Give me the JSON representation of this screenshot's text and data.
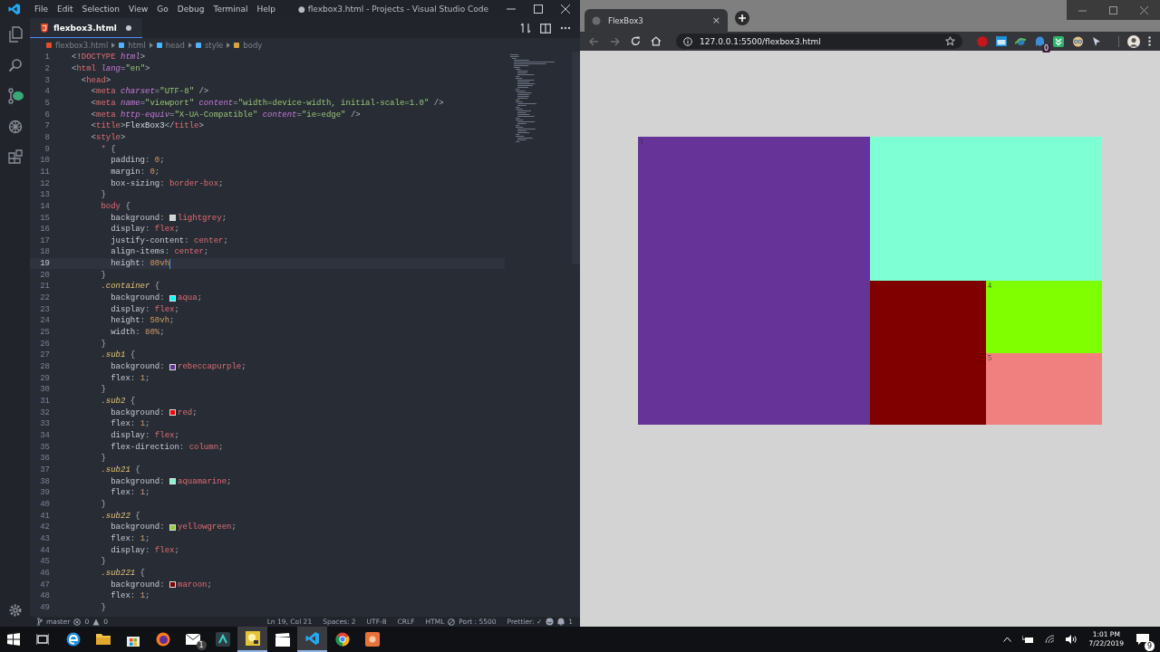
{
  "vscode": {
    "title": "● flexbox3.html - Projects - Visual Studio Code",
    "menu": [
      "File",
      "Edit",
      "Selection",
      "View",
      "Go",
      "Debug",
      "Terminal",
      "Help"
    ],
    "tab": {
      "label": "flexbox3.html",
      "modified": true,
      "selected": true
    },
    "breadcrumbs": [
      {
        "kind": "file",
        "label": "flexbox3.html"
      },
      {
        "kind": "element",
        "label": "html"
      },
      {
        "kind": "element",
        "label": "head"
      },
      {
        "kind": "element",
        "label": "style"
      },
      {
        "kind": "rule",
        "label": "body"
      }
    ],
    "lines": [
      {
        "number": "1",
        "current": false,
        "tokens": [
          {
            "kind": "punct",
            "text": "<!"
          },
          {
            "kind": "tag",
            "text": "DOCTYPE"
          },
          {
            "kind": "attr",
            "text": " html"
          },
          {
            "kind": "punct",
            "text": ">"
          }
        ]
      },
      {
        "number": "2",
        "current": false,
        "tokens": [
          {
            "kind": "punct",
            "text": "<"
          },
          {
            "kind": "tag",
            "text": "html"
          },
          {
            "kind": "attr",
            "text": " lang"
          },
          {
            "kind": "punct",
            "text": "="
          },
          {
            "kind": "string",
            "text": "\"en\""
          },
          {
            "kind": "punct",
            "text": ">"
          }
        ]
      },
      {
        "number": "3",
        "current": false,
        "tokens": [
          {
            "kind": "punct",
            "text": "  <"
          },
          {
            "kind": "tag",
            "text": "head"
          },
          {
            "kind": "punct",
            "text": ">"
          }
        ]
      },
      {
        "number": "4",
        "current": false,
        "tokens": [
          {
            "kind": "punct",
            "text": "    <"
          },
          {
            "kind": "tag",
            "text": "meta"
          },
          {
            "kind": "attr",
            "text": " charset"
          },
          {
            "kind": "punct",
            "text": "="
          },
          {
            "kind": "string",
            "text": "\"UTF-8\""
          },
          {
            "kind": "punct",
            "text": " />"
          }
        ]
      },
      {
        "number": "5",
        "current": false,
        "tokens": [
          {
            "kind": "punct",
            "text": "    <"
          },
          {
            "kind": "tag",
            "text": "meta"
          },
          {
            "kind": "attr",
            "text": " name"
          },
          {
            "kind": "punct",
            "text": "="
          },
          {
            "kind": "string",
            "text": "\"viewport\""
          },
          {
            "kind": "attr",
            "text": " content"
          },
          {
            "kind": "punct",
            "text": "="
          },
          {
            "kind": "string",
            "text": "\"width=device-width, initial-scale=1.0\""
          },
          {
            "kind": "punct",
            "text": " />"
          }
        ]
      },
      {
        "number": "6",
        "current": false,
        "tokens": [
          {
            "kind": "punct",
            "text": "    <"
          },
          {
            "kind": "tag",
            "text": "meta"
          },
          {
            "kind": "attr",
            "text": " http-equiv"
          },
          {
            "kind": "punct",
            "text": "="
          },
          {
            "kind": "string",
            "text": "\"X-UA-Compatible\""
          },
          {
            "kind": "attr",
            "text": " content"
          },
          {
            "kind": "punct",
            "text": "="
          },
          {
            "kind": "string",
            "text": "\"ie=edge\""
          },
          {
            "kind": "punct",
            "text": " />"
          }
        ]
      },
      {
        "number": "7",
        "current": false,
        "tokens": [
          {
            "kind": "punct",
            "text": "    <"
          },
          {
            "kind": "tag",
            "text": "title"
          },
          {
            "kind": "punct",
            "text": ">"
          },
          {
            "kind": "text",
            "text": "FlexBox3"
          },
          {
            "kind": "punct",
            "text": "</"
          },
          {
            "kind": "tag",
            "text": "title"
          },
          {
            "kind": "punct",
            "text": ">"
          }
        ]
      },
      {
        "number": "8",
        "current": false,
        "tokens": [
          {
            "kind": "punct",
            "text": "    <"
          },
          {
            "kind": "tag",
            "text": "style"
          },
          {
            "kind": "punct",
            "text": ">"
          }
        ]
      },
      {
        "number": "9",
        "current": false,
        "tokens": [
          {
            "kind": "tag",
            "text": "      *"
          },
          {
            "kind": "punct",
            "text": " {"
          }
        ]
      },
      {
        "number": "10",
        "current": false,
        "tokens": [
          {
            "kind": "property",
            "text": "        padding"
          },
          {
            "kind": "punct",
            "text": ": "
          },
          {
            "kind": "number",
            "text": "0"
          },
          {
            "kind": "punct",
            "text": ";"
          }
        ]
      },
      {
        "number": "11",
        "current": false,
        "tokens": [
          {
            "kind": "property",
            "text": "        margin"
          },
          {
            "kind": "punct",
            "text": ": "
          },
          {
            "kind": "number",
            "text": "0"
          },
          {
            "kind": "punct",
            "text": ";"
          }
        ]
      },
      {
        "number": "12",
        "current": false,
        "tokens": [
          {
            "kind": "property",
            "text": "        box-sizing"
          },
          {
            "kind": "punct",
            "text": ": "
          },
          {
            "kind": "value",
            "text": "border-box"
          },
          {
            "kind": "punct",
            "text": ";"
          }
        ]
      },
      {
        "number": "13",
        "current": false,
        "tokens": [
          {
            "kind": "punct",
            "text": "      }"
          }
        ]
      },
      {
        "number": "14",
        "current": false,
        "tokens": [
          {
            "kind": "tag",
            "text": "      body"
          },
          {
            "kind": "punct",
            "text": " {"
          }
        ]
      },
      {
        "number": "15",
        "current": false,
        "tokens": [
          {
            "kind": "property",
            "text": "        background"
          },
          {
            "kind": "punct",
            "text": ": "
          },
          {
            "kind": "swatch",
            "color": "#d3d3d3"
          },
          {
            "kind": "value",
            "text": "lightgrey"
          },
          {
            "kind": "punct",
            "text": ";"
          }
        ]
      },
      {
        "number": "16",
        "current": false,
        "tokens": [
          {
            "kind": "property",
            "text": "        display"
          },
          {
            "kind": "punct",
            "text": ": "
          },
          {
            "kind": "value",
            "text": "flex"
          },
          {
            "kind": "punct",
            "text": ";"
          }
        ]
      },
      {
        "number": "17",
        "current": false,
        "tokens": [
          {
            "kind": "property",
            "text": "        justify-content"
          },
          {
            "kind": "punct",
            "text": ": "
          },
          {
            "kind": "value",
            "text": "center"
          },
          {
            "kind": "punct",
            "text": ";"
          }
        ]
      },
      {
        "number": "18",
        "current": false,
        "tokens": [
          {
            "kind": "property",
            "text": "        align-items"
          },
          {
            "kind": "punct",
            "text": ": "
          },
          {
            "kind": "value",
            "text": "center"
          },
          {
            "kind": "punct",
            "text": ";"
          }
        ]
      },
      {
        "number": "19",
        "current": true,
        "tokens": [
          {
            "kind": "property",
            "text": "        height"
          },
          {
            "kind": "punct",
            "text": ": "
          },
          {
            "kind": "number",
            "text": "80vh"
          }
        ]
      },
      {
        "number": "20",
        "current": false,
        "tokens": [
          {
            "kind": "punct",
            "text": "      }"
          }
        ]
      },
      {
        "number": "21",
        "current": false,
        "tokens": [
          {
            "kind": "class",
            "text": "      .container"
          },
          {
            "kind": "punct",
            "text": " {"
          }
        ]
      },
      {
        "number": "22",
        "current": false,
        "tokens": [
          {
            "kind": "property",
            "text": "        background"
          },
          {
            "kind": "punct",
            "text": ": "
          },
          {
            "kind": "swatch",
            "color": "#00ffff"
          },
          {
            "kind": "value",
            "text": "aqua"
          },
          {
            "kind": "punct",
            "text": ";"
          }
        ]
      },
      {
        "number": "23",
        "current": false,
        "tokens": [
          {
            "kind": "property",
            "text": "        display"
          },
          {
            "kind": "punct",
            "text": ": "
          },
          {
            "kind": "value",
            "text": "flex"
          },
          {
            "kind": "punct",
            "text": ";"
          }
        ]
      },
      {
        "number": "24",
        "current": false,
        "tokens": [
          {
            "kind": "property",
            "text": "        height"
          },
          {
            "kind": "punct",
            "text": ": "
          },
          {
            "kind": "number",
            "text": "50vh"
          },
          {
            "kind": "punct",
            "text": ";"
          }
        ]
      },
      {
        "number": "25",
        "current": false,
        "tokens": [
          {
            "kind": "property",
            "text": "        width"
          },
          {
            "kind": "punct",
            "text": ": "
          },
          {
            "kind": "number",
            "text": "80%"
          },
          {
            "kind": "punct",
            "text": ";"
          }
        ]
      },
      {
        "number": "26",
        "current": false,
        "tokens": [
          {
            "kind": "punct",
            "text": "      }"
          }
        ]
      },
      {
        "number": "27",
        "current": false,
        "tokens": [
          {
            "kind": "class",
            "text": "      .sub1"
          },
          {
            "kind": "punct",
            "text": " {"
          }
        ]
      },
      {
        "number": "28",
        "current": false,
        "tokens": [
          {
            "kind": "property",
            "text": "        background"
          },
          {
            "kind": "punct",
            "text": ": "
          },
          {
            "kind": "swatch",
            "color": "#663399"
          },
          {
            "kind": "value",
            "text": "rebeccapurple"
          },
          {
            "kind": "punct",
            "text": ";"
          }
        ]
      },
      {
        "number": "29",
        "current": false,
        "tokens": [
          {
            "kind": "property",
            "text": "        flex"
          },
          {
            "kind": "punct",
            "text": ": "
          },
          {
            "kind": "number",
            "text": "1"
          },
          {
            "kind": "punct",
            "text": ";"
          }
        ]
      },
      {
        "number": "30",
        "current": false,
        "tokens": [
          {
            "kind": "punct",
            "text": "      }"
          }
        ]
      },
      {
        "number": "31",
        "current": false,
        "tokens": [
          {
            "kind": "class",
            "text": "      .sub2"
          },
          {
            "kind": "punct",
            "text": " {"
          }
        ]
      },
      {
        "number": "32",
        "current": false,
        "tokens": [
          {
            "kind": "property",
            "text": "        background"
          },
          {
            "kind": "punct",
            "text": ": "
          },
          {
            "kind": "swatch",
            "color": "#ff0000"
          },
          {
            "kind": "value",
            "text": "red"
          },
          {
            "kind": "punct",
            "text": ";"
          }
        ]
      },
      {
        "number": "33",
        "current": false,
        "tokens": [
          {
            "kind": "property",
            "text": "        flex"
          },
          {
            "kind": "punct",
            "text": ": "
          },
          {
            "kind": "number",
            "text": "1"
          },
          {
            "kind": "punct",
            "text": ";"
          }
        ]
      },
      {
        "number": "34",
        "current": false,
        "tokens": [
          {
            "kind": "property",
            "text": "        display"
          },
          {
            "kind": "punct",
            "text": ": "
          },
          {
            "kind": "value",
            "text": "flex"
          },
          {
            "kind": "punct",
            "text": ";"
          }
        ]
      },
      {
        "number": "35",
        "current": false,
        "tokens": [
          {
            "kind": "property",
            "text": "        flex-direction"
          },
          {
            "kind": "punct",
            "text": ": "
          },
          {
            "kind": "value",
            "text": "column"
          },
          {
            "kind": "punct",
            "text": ";"
          }
        ]
      },
      {
        "number": "36",
        "current": false,
        "tokens": [
          {
            "kind": "punct",
            "text": "      }"
          }
        ]
      },
      {
        "number": "37",
        "current": false,
        "tokens": [
          {
            "kind": "class",
            "text": "      .sub21"
          },
          {
            "kind": "punct",
            "text": " {"
          }
        ]
      },
      {
        "number": "38",
        "current": false,
        "tokens": [
          {
            "kind": "property",
            "text": "        background"
          },
          {
            "kind": "punct",
            "text": ": "
          },
          {
            "kind": "swatch",
            "color": "#7fffd4"
          },
          {
            "kind": "value",
            "text": "aquamarine"
          },
          {
            "kind": "punct",
            "text": ";"
          }
        ]
      },
      {
        "number": "39",
        "current": false,
        "tokens": [
          {
            "kind": "property",
            "text": "        flex"
          },
          {
            "kind": "punct",
            "text": ": "
          },
          {
            "kind": "number",
            "text": "1"
          },
          {
            "kind": "punct",
            "text": ";"
          }
        ]
      },
      {
        "number": "40",
        "current": false,
        "tokens": [
          {
            "kind": "punct",
            "text": "      }"
          }
        ]
      },
      {
        "number": "41",
        "current": false,
        "tokens": [
          {
            "kind": "class",
            "text": "      .sub22"
          },
          {
            "kind": "punct",
            "text": " {"
          }
        ]
      },
      {
        "number": "42",
        "current": false,
        "tokens": [
          {
            "kind": "property",
            "text": "        background"
          },
          {
            "kind": "punct",
            "text": ": "
          },
          {
            "kind": "swatch",
            "color": "#9acd32"
          },
          {
            "kind": "value",
            "text": "yellowgreen"
          },
          {
            "kind": "punct",
            "text": ";"
          }
        ]
      },
      {
        "number": "43",
        "current": false,
        "tokens": [
          {
            "kind": "property",
            "text": "        flex"
          },
          {
            "kind": "punct",
            "text": ": "
          },
          {
            "kind": "number",
            "text": "1"
          },
          {
            "kind": "punct",
            "text": ";"
          }
        ]
      },
      {
        "number": "44",
        "current": false,
        "tokens": [
          {
            "kind": "property",
            "text": "        display"
          },
          {
            "kind": "punct",
            "text": ": "
          },
          {
            "kind": "value",
            "text": "flex"
          },
          {
            "kind": "punct",
            "text": ";"
          }
        ]
      },
      {
        "number": "45",
        "current": false,
        "tokens": [
          {
            "kind": "punct",
            "text": "      }"
          }
        ]
      },
      {
        "number": "46",
        "current": false,
        "tokens": [
          {
            "kind": "class",
            "text": "      .sub221"
          },
          {
            "kind": "punct",
            "text": " {"
          }
        ]
      },
      {
        "number": "47",
        "current": false,
        "tokens": [
          {
            "kind": "property",
            "text": "        background"
          },
          {
            "kind": "punct",
            "text": ": "
          },
          {
            "kind": "swatch",
            "color": "#800000"
          },
          {
            "kind": "value",
            "text": "maroon"
          },
          {
            "kind": "punct",
            "text": ";"
          }
        ]
      },
      {
        "number": "48",
        "current": false,
        "tokens": [
          {
            "kind": "property",
            "text": "        flex"
          },
          {
            "kind": "punct",
            "text": ": "
          },
          {
            "kind": "number",
            "text": "1"
          },
          {
            "kind": "punct",
            "text": ";"
          }
        ]
      },
      {
        "number": "49",
        "current": false,
        "tokens": [
          {
            "kind": "punct",
            "text": "      }"
          }
        ]
      }
    ],
    "status_bar": {
      "branch": "master",
      "errors": "0",
      "warnings": "0",
      "items": [
        "Ln 19, Col 21",
        "Spaces: 2",
        "UTF-8",
        "CRLF",
        "HTML"
      ],
      "port": "Port : 5500",
      "prettier": "Prettier: ✓",
      "notifications": "1"
    }
  },
  "browser": {
    "tab": {
      "label": "FlexBox3",
      "close": "×"
    },
    "url": "127.0.0.1:5500/flexbox3.html",
    "extension_badge": "0",
    "page": {
      "boxes": [
        {
          "color": "#663399",
          "label": "1"
        },
        {
          "color": "#7fffd4"
        },
        {
          "color": "#800000"
        },
        {
          "color": "#7fff00",
          "label": "4"
        },
        {
          "color": "#f08080",
          "label": "5"
        }
      ]
    }
  },
  "taskbar": {
    "apps": [
      {
        "kind": "edge",
        "active": false
      },
      {
        "kind": "folder",
        "active": false
      },
      {
        "kind": "store",
        "active": false
      },
      {
        "kind": "firefox",
        "active": false
      },
      {
        "kind": "mail",
        "active": false,
        "badge": "1"
      },
      {
        "kind": "film",
        "active": false
      },
      {
        "kind": "yellow",
        "active": true
      },
      {
        "kind": "clapper",
        "active": false
      },
      {
        "kind": "vscode",
        "active": true
      },
      {
        "kind": "chrome",
        "active": false
      },
      {
        "kind": "orange",
        "active": false
      }
    ],
    "time": "1:01 PM",
    "date": "7/22/2019",
    "notification_count": "9"
  }
}
